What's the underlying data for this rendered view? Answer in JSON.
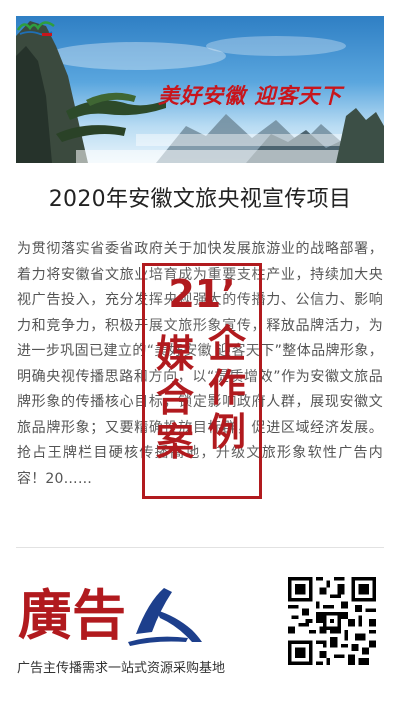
{
  "banner": {
    "slogan": "美好安徽 迎客天下",
    "logo_icon": "anhui-tourism-logo-icon"
  },
  "article": {
    "title": "2020年安徽文旅央视宣传项目",
    "body": "为贯彻落实省委省政府关于加快发展旅游业的战略部署，着力将安徽省文旅业培育成为重要支柱产业，持续加大央视广告投入，充分发挥央视强大的传播力、公信力、影响力和竞争力，积极开展文旅形象宣传，释放品牌活力，为进一步巩固已建立的“美好安徽 迎客天下”整体品牌形象，明确央视传播思路和方向，以“提质增效”作为安徽文旅品牌形象的传播核心目标，锁定影响政府人群，展现安徽文旅品牌形象；又要精确投放目标群，促进区域经济发展。抢占王牌栏目硬核传播高地，升级文旅形象软性广告内容！20……"
  },
  "stamp": {
    "number": "21’",
    "left_chars": [
      "媒",
      "合",
      "案"
    ],
    "right_chars": [
      "企",
      "作",
      "例"
    ]
  },
  "footer": {
    "brand_name": "廣告人",
    "tagline": "广告主传播需求一站式资源采购基地",
    "qr_icon": "qr-code-icon"
  },
  "colors": {
    "brand_red": "#b11a1e",
    "slogan_red": "#c8151c",
    "brand_blue": "#1d3f8c"
  }
}
